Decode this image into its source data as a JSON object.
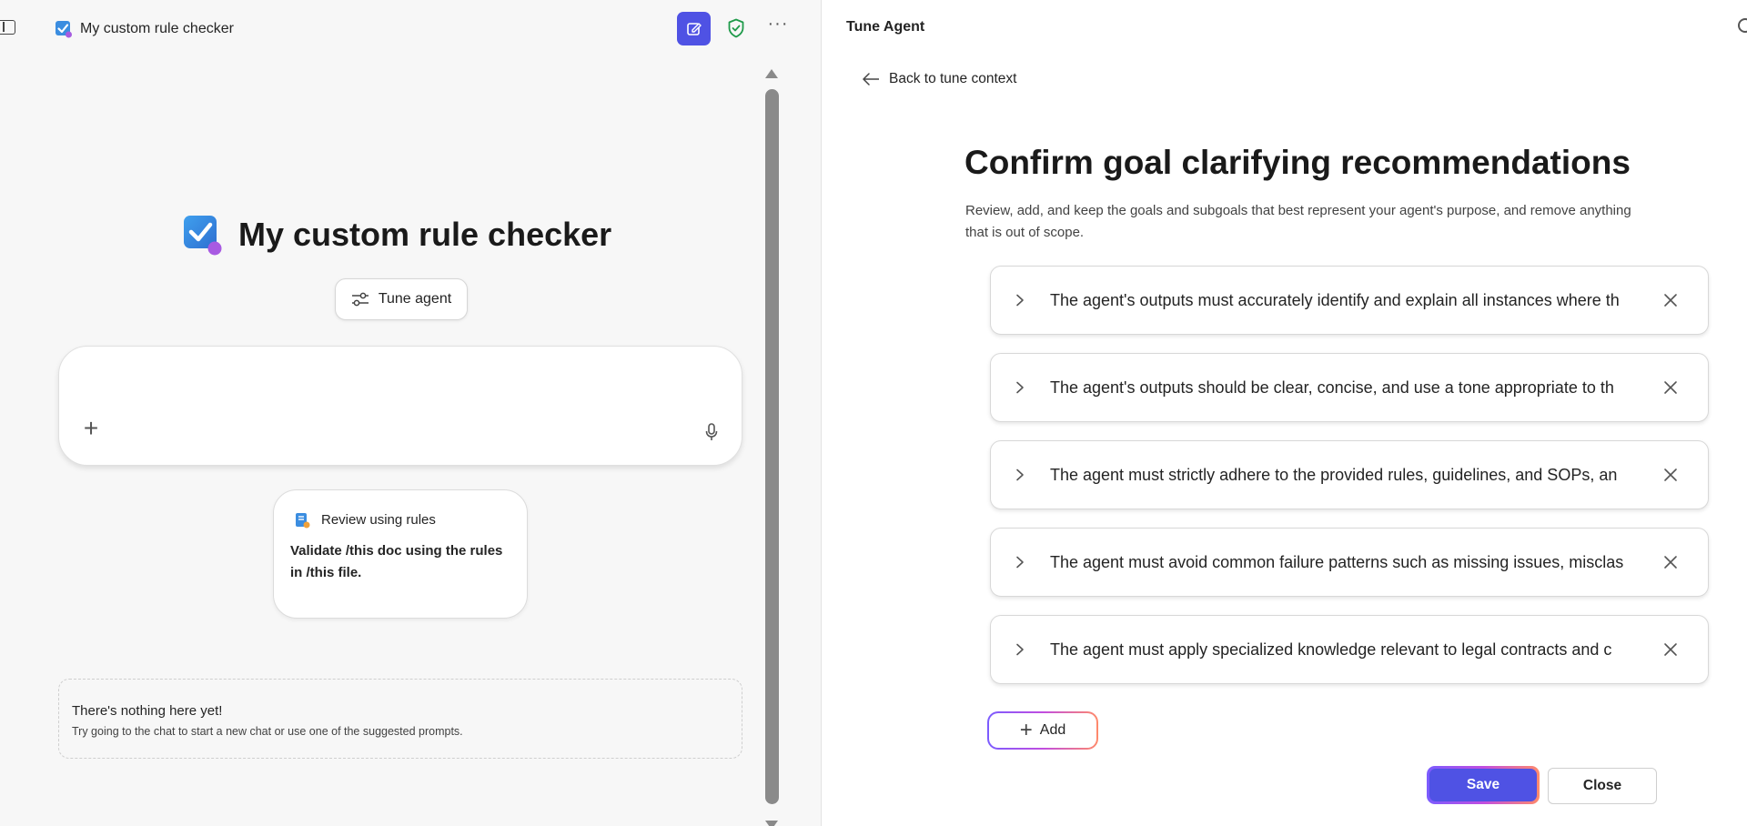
{
  "header": {
    "app_title": "My custom rule checker",
    "icons": [
      "panel-toggle-icon",
      "app-icon",
      "compose-icon",
      "shield-check-icon",
      "more-icon"
    ]
  },
  "hero": {
    "title": "My custom rule checker",
    "tune_label": "Tune agent"
  },
  "chat": {
    "input_value": "",
    "input_placeholder": ""
  },
  "prompt_card": {
    "title": "Review using rules",
    "text": "Validate /this doc using the rules in /this file."
  },
  "empty_state": {
    "title": "There's nothing here yet!",
    "subtitle": "Try going to the chat to start a new chat or use one of the suggested prompts."
  },
  "right_panel": {
    "title": "Tune Agent",
    "back_label": "Back to tune context",
    "heading": "Confirm goal clarifying recommendations",
    "description": "Review, add, and keep the goals and subgoals that best represent your agent's purpose, and remove anything that is out of scope.",
    "goals": [
      "The agent's outputs must accurately identify and explain all instances where th",
      "The agent's outputs should be clear, concise, and use a tone appropriate to th",
      "The agent must strictly adhere to the provided rules, guidelines, and SOPs, an",
      "The agent must avoid common failure patterns such as missing issues, misclas",
      "The agent must apply specialized knowledge relevant to legal contracts and c"
    ],
    "add_label": "Add",
    "save_label": "Save",
    "close_label": "Close"
  },
  "colors": {
    "accent": "#4f52e4",
    "shield_green": "#1f9a4a",
    "gradient": [
      "#7b5cff",
      "#c04de0",
      "#ff8a6b"
    ]
  }
}
